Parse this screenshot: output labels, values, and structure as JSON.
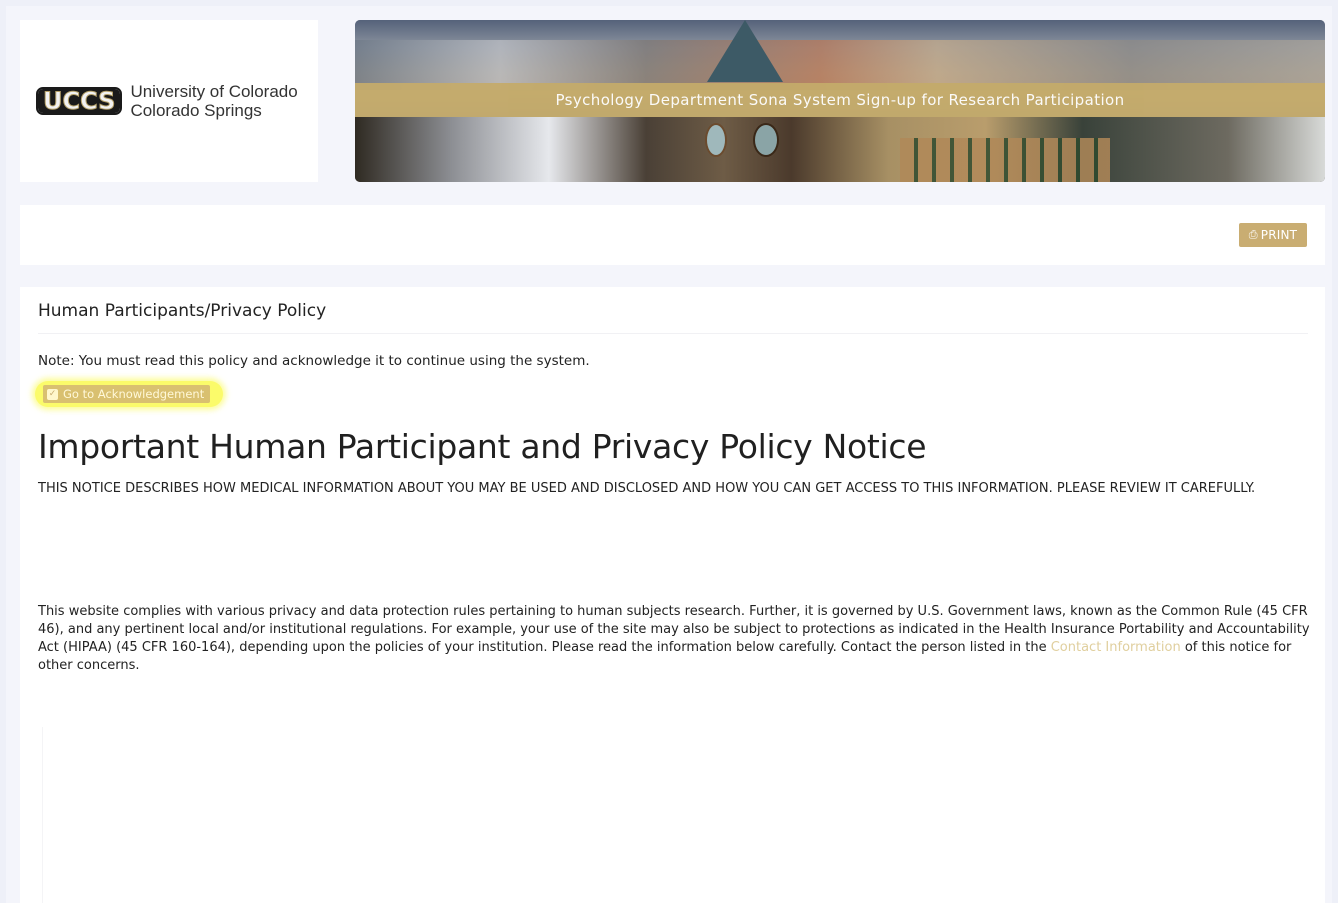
{
  "header": {
    "logo_mark": "UCCS",
    "logo_line1": "University of Colorado",
    "logo_line2": "Colorado Springs",
    "banner_text": "Psychology Department Sona System Sign-up for Research Participation"
  },
  "toolbar": {
    "print_label": "PRINT",
    "print_icon": "printer-icon"
  },
  "content": {
    "section_title": "Human Participants/Privacy Policy",
    "note": "Note:  You must read this policy and acknowledge it to continue using the system.",
    "ack_button_label": "Go to Acknowledgement",
    "ack_icon": "checkbox-icon",
    "main_title": "Important Human Participant and Privacy Policy Notice",
    "caps_notice": "THIS NOTICE DESCRIBES HOW MEDICAL INFORMATION ABOUT YOU MAY BE USED AND DISCLOSED AND HOW YOU CAN GET ACCESS TO THIS INFORMATION. PLEASE REVIEW IT CAREFULLY.",
    "body_before_link": "This website complies with various privacy and data protection rules pertaining to human subjects research. Further, it is governed by U.S. Government laws, known as the Common Rule (45 CFR 46), and any pertinent local and/or institutional regulations. For example, your use of the site may also be subject to protections as indicated in the Health Insurance Portability and Accountability Act (HIPAA) (45 CFR 160-164), depending upon the policies of your institution. Please read the information below carefully. Contact the person listed in the ",
    "body_link": "Contact Information",
    "body_after_link": " of this notice for other concerns."
  },
  "colors": {
    "accent_gold": "#c9ad72",
    "highlight_yellow": "#fbfb6a",
    "page_bg": "#eef0f8"
  }
}
